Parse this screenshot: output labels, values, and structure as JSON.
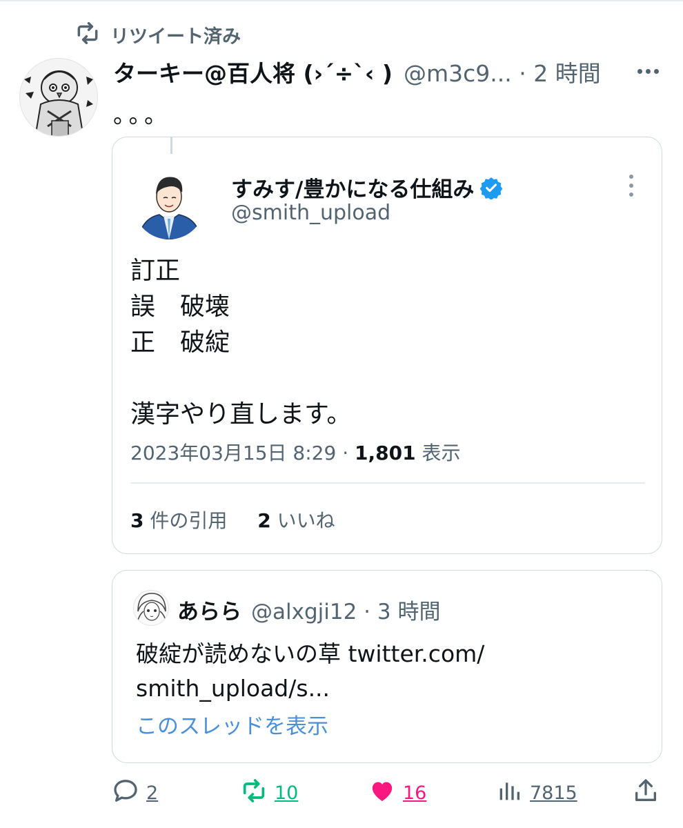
{
  "retweet_header": {
    "label": "リツイート済み",
    "icon": "retweet-icon"
  },
  "tweet": {
    "display_name": "ターキー@百人将 (›´÷`‹ )",
    "handle_time": "@m3c9... · 2 時間",
    "text": "。。。",
    "more_icon": "more-horizontal-icon"
  },
  "quoted_tweet": {
    "display_name": "すみす/豊かになる仕組み",
    "handle": "@smith_upload",
    "verified": true,
    "verified_color": "#1d9bf0",
    "body_lines": [
      "訂正",
      "誤　破壊",
      "正　破綻",
      "",
      "漢字やり直します。"
    ],
    "timestamp": "2023年03月15日 8:29 · ",
    "views_count": "1,801",
    "views_label": " 表示",
    "quotes_count": "3",
    "quotes_label": " 件の引用",
    "likes_count": "2",
    "likes_label": " いいね",
    "more_icon": "more-vertical-icon"
  },
  "thread_reply": {
    "display_name": "あらら",
    "handle_time": "@alxgji12 · 3 時間",
    "body_lines": [
      "破綻が読めないの草 twitter.com/",
      "smith_upload/s..."
    ],
    "show_thread_link": "このスレッドを表示"
  },
  "action_bar": {
    "reply_count": "2",
    "retweet_count": "10",
    "like_count": "16",
    "views_count": "7815",
    "colors": {
      "retweet": "#00ba7c",
      "like": "#f91880",
      "neutral": "#536471"
    }
  }
}
